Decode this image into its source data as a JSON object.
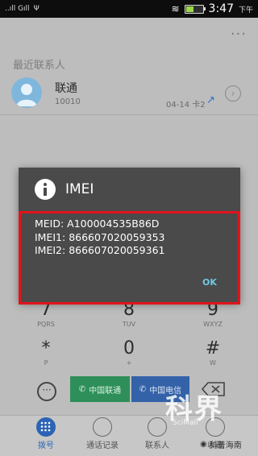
{
  "statusbar": {
    "signal_text": "..ıll Gıll",
    "time": "3:47",
    "ampm": "下午",
    "battery_level": 0.45
  },
  "contacts": {
    "section_title": "最近联系人",
    "items": [
      {
        "name": "联通",
        "number": "10010",
        "meta": "04-14 卡2"
      }
    ]
  },
  "dialog": {
    "title": "IMEI",
    "lines": [
      "MEID: A100004535B86D",
      "IMEI1: 866607020059353",
      "IMEI2: 866607020059361"
    ],
    "ok_label": "OK"
  },
  "dialpad": {
    "keys": [
      {
        "digit": "7",
        "letters": "PQRS"
      },
      {
        "digit": "8",
        "letters": "TUV"
      },
      {
        "digit": "9",
        "letters": "WXYZ"
      },
      {
        "digit": "*",
        "letters": "P"
      },
      {
        "digit": "0",
        "letters": "+"
      },
      {
        "digit": "#",
        "letters": "W"
      }
    ]
  },
  "actions": {
    "call1_label": "中国联通",
    "call2_label": "中国电信"
  },
  "nav": {
    "items": [
      {
        "label": "拨号",
        "icon": "dialpad-icon"
      },
      {
        "label": "通话记录",
        "icon": "call-log-icon"
      },
      {
        "label": "联系人",
        "icon": "contacts-icon"
      },
      {
        "label": "收藏",
        "icon": "favorites-icon"
      }
    ]
  },
  "watermark": {
    "main": "科界",
    "sub": "SciMall",
    "account": "科普海南"
  },
  "colors": {
    "dialog_bg": "#4a4a4a",
    "highlight_border": "#e1141b",
    "ok_text": "#6fc7e6",
    "call1_bg": "#2f8f5a",
    "call2_bg": "#3462a8",
    "nav_active": "#2c64b5"
  }
}
